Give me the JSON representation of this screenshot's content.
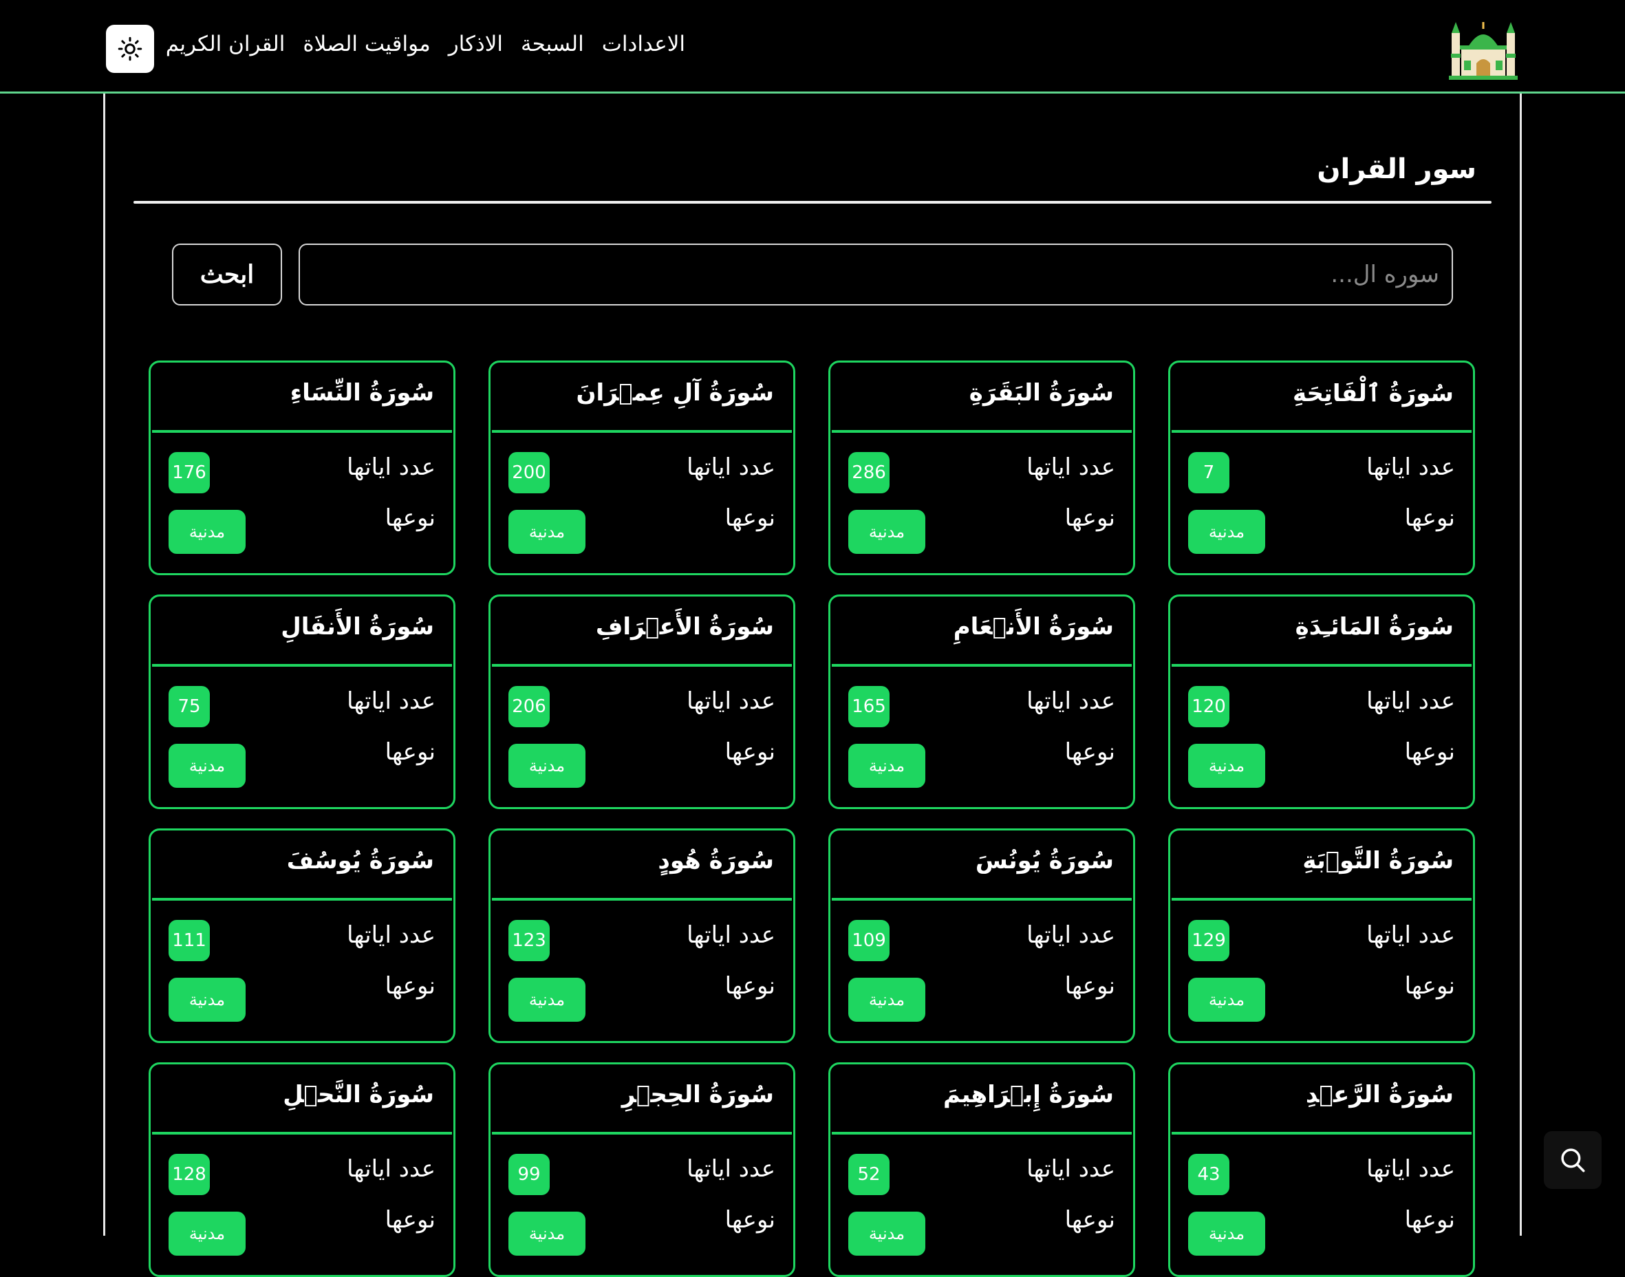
{
  "header": {
    "nav": [
      {
        "label": "القران الكريم"
      },
      {
        "label": "مواقيت الصلاة"
      },
      {
        "label": "الاذكار"
      },
      {
        "label": "السبحة"
      },
      {
        "label": "الاعدادات"
      }
    ],
    "theme_icon": "sun-icon",
    "logo_icon": "mosque-icon"
  },
  "main": {
    "title": "سور القران",
    "search": {
      "placeholder": "سوره ال...",
      "value": "",
      "button_label": "ابحث"
    },
    "count_label": "عدد اياتها",
    "type_label": "نوعها",
    "surahs": [
      {
        "name": "سُورَةُ ٱلْفَاتِحَةِ",
        "ayahs": "7",
        "type": "مدنية"
      },
      {
        "name": "سُورَةُ البَقَرَةِ",
        "ayahs": "286",
        "type": "مدنية"
      },
      {
        "name": "سُورَةُ آلِ عِمۡرَانَ",
        "ayahs": "200",
        "type": "مدنية"
      },
      {
        "name": "سُورَةُ النِّسَاءِ",
        "ayahs": "176",
        "type": "مدنية"
      },
      {
        "name": "سُورَةُ المَائـِدَةِ",
        "ayahs": "120",
        "type": "مدنية"
      },
      {
        "name": "سُورَةُ الأَنۡعَامِ",
        "ayahs": "165",
        "type": "مدنية"
      },
      {
        "name": "سُورَةُ الأَعۡرَافِ",
        "ayahs": "206",
        "type": "مدنية"
      },
      {
        "name": "سُورَةُ الأَنفَالِ",
        "ayahs": "75",
        "type": "مدنية"
      },
      {
        "name": "سُورَةُ التَّوۡبَةِ",
        "ayahs": "129",
        "type": "مدنية"
      },
      {
        "name": "سُورَةُ يُونُسَ",
        "ayahs": "109",
        "type": "مدنية"
      },
      {
        "name": "سُورَةُ هُودٍ",
        "ayahs": "123",
        "type": "مدنية"
      },
      {
        "name": "سُورَةُ يُوسُفَ",
        "ayahs": "111",
        "type": "مدنية"
      },
      {
        "name": "سُورَةُ الرَّعۡدِ",
        "ayahs": "43",
        "type": "مدنية"
      },
      {
        "name": "سُورَةُ إِبۡرَاهِيمَ",
        "ayahs": "52",
        "type": "مدنية"
      },
      {
        "name": "سُورَةُ الحِجۡرِ",
        "ayahs": "99",
        "type": "مدنية"
      },
      {
        "name": "سُورَةُ النَّحۡلِ",
        "ayahs": "128",
        "type": "مدنية"
      }
    ]
  },
  "fab_icon": "search-icon",
  "colors": {
    "accent": "#1ed660",
    "header_border": "#5fd58c",
    "background": "#000000"
  }
}
